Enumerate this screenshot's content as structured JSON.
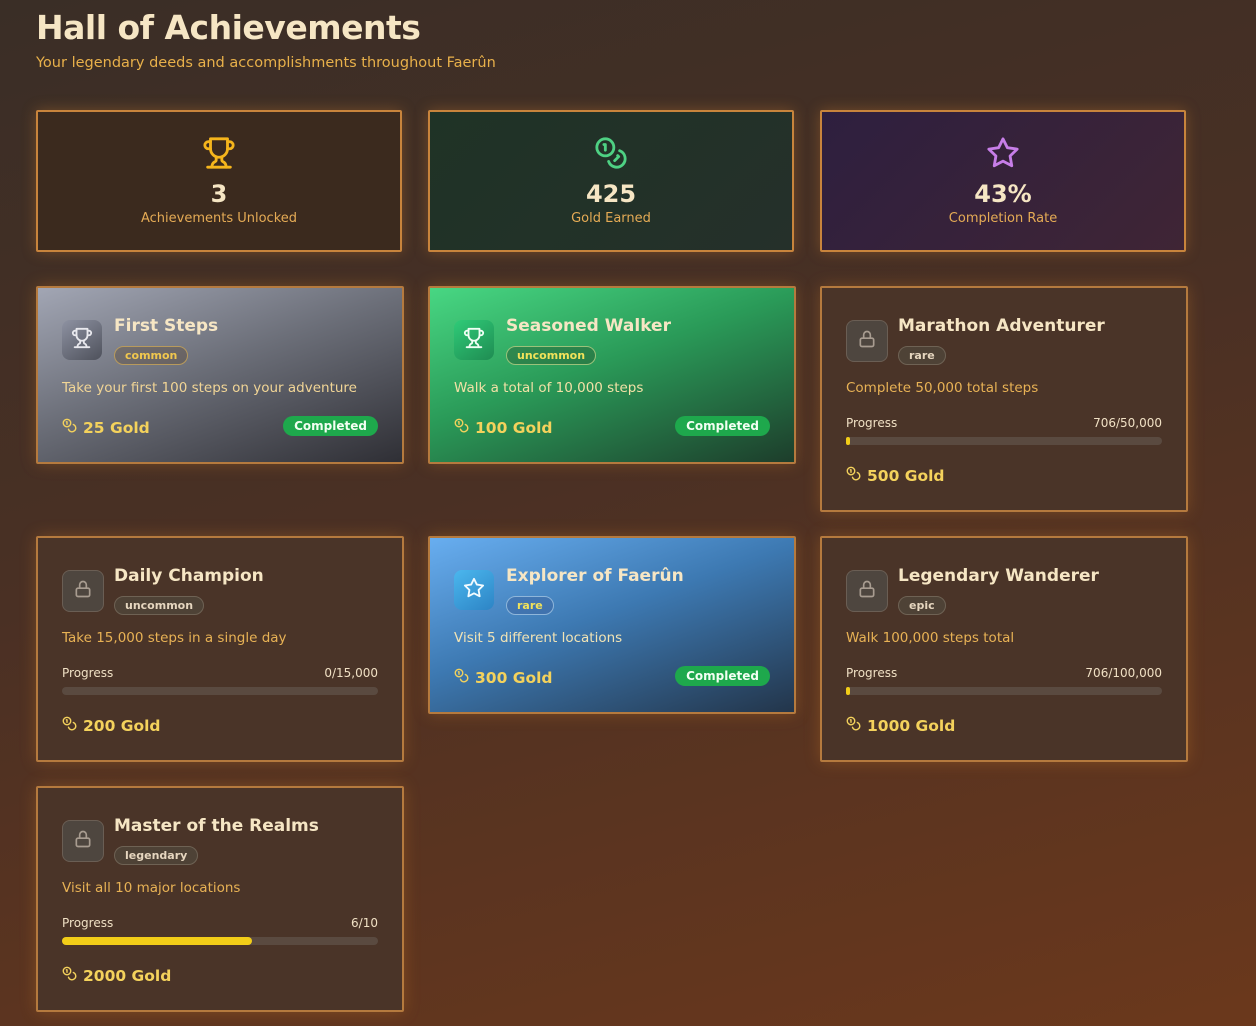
{
  "header": {
    "title": "Hall of Achievements",
    "subtitle": "Your legendary deeds and accomplishments throughout Faerûn"
  },
  "stats": [
    {
      "value": "3",
      "label": "Achievements Unlocked",
      "icon": "trophy-icon",
      "color": "#f5b51c"
    },
    {
      "value": "425",
      "label": "Gold Earned",
      "icon": "coins-icon",
      "color": "#4ed183"
    },
    {
      "value": "43%",
      "label": "Completion Rate",
      "icon": "star-icon",
      "color": "#c77ee8"
    }
  ],
  "achievements": [
    {
      "title": "First Steps",
      "rarity": "common",
      "description": "Take your first 100 steps on your adventure",
      "reward": "25 Gold",
      "status": "Completed",
      "icon": "trophy-icon"
    },
    {
      "title": "Seasoned Walker",
      "rarity": "uncommon",
      "description": "Walk a total of 10,000 steps",
      "reward": "100 Gold",
      "status": "Completed",
      "icon": "trophy-icon"
    },
    {
      "title": "Marathon Adventurer",
      "rarity": "rare",
      "description": "Complete 50,000 total steps",
      "progress_label": "Progress",
      "progress_text": "706/50,000",
      "progress": 0.01412,
      "reward": "500 Gold",
      "icon": "lock-icon"
    },
    {
      "title": "Daily Champion",
      "rarity": "uncommon",
      "description": "Take 15,000 steps in a single day",
      "progress_label": "Progress",
      "progress_text": "0/15,000",
      "progress": 0,
      "reward": "200 Gold",
      "icon": "lock-icon"
    },
    {
      "title": "Explorer of Faerûn",
      "rarity": "rare",
      "description": "Visit 5 different locations",
      "reward": "300 Gold",
      "status": "Completed",
      "icon": "star-icon"
    },
    {
      "title": "Legendary Wanderer",
      "rarity": "epic",
      "description": "Walk 100,000 steps total",
      "progress_label": "Progress",
      "progress_text": "706/100,000",
      "progress": 0.00706,
      "reward": "1000 Gold",
      "icon": "lock-icon"
    },
    {
      "title": "Master of the Realms",
      "rarity": "legendary",
      "description": "Visit all 10 major locations",
      "progress_label": "Progress",
      "progress_text": "6/10",
      "progress": 0.6,
      "reward": "2000 Gold",
      "icon": "lock-icon"
    }
  ],
  "colors": {
    "progress_fill": "#f2cd18",
    "completed_badge": "#1ea84c",
    "gold_text": "#f4d25c"
  }
}
